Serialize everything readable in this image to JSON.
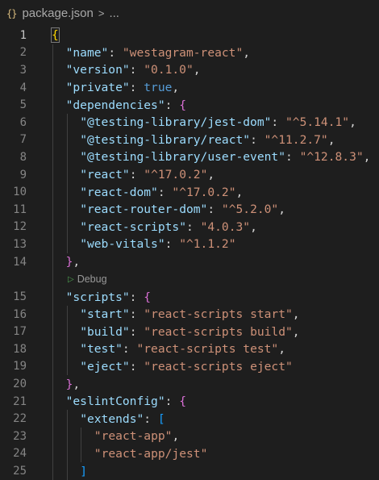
{
  "breadcrumb": {
    "icon": "{}",
    "file": "package.json",
    "more": "..."
  },
  "codelens": {
    "label": "Debug"
  },
  "lines": [
    {
      "n": "1",
      "tokens": [
        [
          "br0",
          "{"
        ]
      ]
    },
    {
      "n": "2",
      "tokens": [
        [
          "k",
          "\"name\""
        ],
        [
          "p",
          ": "
        ],
        [
          "s",
          "\"westagram-react\""
        ],
        [
          "p",
          ","
        ]
      ]
    },
    {
      "n": "3",
      "tokens": [
        [
          "k",
          "\"version\""
        ],
        [
          "p",
          ": "
        ],
        [
          "s",
          "\"0.1.0\""
        ],
        [
          "p",
          ","
        ]
      ]
    },
    {
      "n": "4",
      "tokens": [
        [
          "k",
          "\"private\""
        ],
        [
          "p",
          ": "
        ],
        [
          "b",
          "true"
        ],
        [
          "p",
          ","
        ]
      ]
    },
    {
      "n": "5",
      "tokens": [
        [
          "k",
          "\"dependencies\""
        ],
        [
          "p",
          ": "
        ],
        [
          "br1",
          "{"
        ]
      ]
    },
    {
      "n": "6",
      "tokens": [
        [
          "k",
          "\"@testing-library/jest-dom\""
        ],
        [
          "p",
          ": "
        ],
        [
          "s",
          "\"^5.14.1\""
        ],
        [
          "p",
          ","
        ]
      ]
    },
    {
      "n": "7",
      "tokens": [
        [
          "k",
          "\"@testing-library/react\""
        ],
        [
          "p",
          ": "
        ],
        [
          "s",
          "\"^11.2.7\""
        ],
        [
          "p",
          ","
        ]
      ]
    },
    {
      "n": "8",
      "tokens": [
        [
          "k",
          "\"@testing-library/user-event\""
        ],
        [
          "p",
          ": "
        ],
        [
          "s",
          "\"^12.8.3\""
        ],
        [
          "p",
          ","
        ]
      ]
    },
    {
      "n": "9",
      "tokens": [
        [
          "k",
          "\"react\""
        ],
        [
          "p",
          ": "
        ],
        [
          "s",
          "\"^17.0.2\""
        ],
        [
          "p",
          ","
        ]
      ]
    },
    {
      "n": "10",
      "tokens": [
        [
          "k",
          "\"react-dom\""
        ],
        [
          "p",
          ": "
        ],
        [
          "s",
          "\"^17.0.2\""
        ],
        [
          "p",
          ","
        ]
      ]
    },
    {
      "n": "11",
      "tokens": [
        [
          "k",
          "\"react-router-dom\""
        ],
        [
          "p",
          ": "
        ],
        [
          "s",
          "\"^5.2.0\""
        ],
        [
          "p",
          ","
        ]
      ]
    },
    {
      "n": "12",
      "tokens": [
        [
          "k",
          "\"react-scripts\""
        ],
        [
          "p",
          ": "
        ],
        [
          "s",
          "\"4.0.3\""
        ],
        [
          "p",
          ","
        ]
      ]
    },
    {
      "n": "13",
      "tokens": [
        [
          "k",
          "\"web-vitals\""
        ],
        [
          "p",
          ": "
        ],
        [
          "s",
          "\"^1.1.2\""
        ]
      ]
    },
    {
      "n": "14",
      "tokens": [
        [
          "br1",
          "}"
        ],
        [
          "p",
          ","
        ]
      ]
    },
    {
      "n": "15",
      "tokens": [
        [
          "k",
          "\"scripts\""
        ],
        [
          "p",
          ": "
        ],
        [
          "br1",
          "{"
        ]
      ]
    },
    {
      "n": "16",
      "tokens": [
        [
          "k",
          "\"start\""
        ],
        [
          "p",
          ": "
        ],
        [
          "s",
          "\"react-scripts start\""
        ],
        [
          "p",
          ","
        ]
      ]
    },
    {
      "n": "17",
      "tokens": [
        [
          "k",
          "\"build\""
        ],
        [
          "p",
          ": "
        ],
        [
          "s",
          "\"react-scripts build\""
        ],
        [
          "p",
          ","
        ]
      ]
    },
    {
      "n": "18",
      "tokens": [
        [
          "k",
          "\"test\""
        ],
        [
          "p",
          ": "
        ],
        [
          "s",
          "\"react-scripts test\""
        ],
        [
          "p",
          ","
        ]
      ]
    },
    {
      "n": "19",
      "tokens": [
        [
          "k",
          "\"eject\""
        ],
        [
          "p",
          ": "
        ],
        [
          "s",
          "\"react-scripts eject\""
        ]
      ]
    },
    {
      "n": "20",
      "tokens": [
        [
          "br1",
          "}"
        ],
        [
          "p",
          ","
        ]
      ]
    },
    {
      "n": "21",
      "tokens": [
        [
          "k",
          "\"eslintConfig\""
        ],
        [
          "p",
          ": "
        ],
        [
          "br1",
          "{"
        ]
      ]
    },
    {
      "n": "22",
      "tokens": [
        [
          "k",
          "\"extends\""
        ],
        [
          "p",
          ": "
        ],
        [
          "br2",
          "["
        ]
      ]
    },
    {
      "n": "23",
      "tokens": [
        [
          "s",
          "\"react-app\""
        ],
        [
          "p",
          ","
        ]
      ]
    },
    {
      "n": "24",
      "tokens": [
        [
          "s",
          "\"react-app/jest\""
        ]
      ]
    },
    {
      "n": "25",
      "tokens": [
        [
          "br2",
          "]"
        ]
      ]
    }
  ],
  "colors": {
    "background": "#1e1e1e",
    "key": "#9cdcfe",
    "string": "#ce9178",
    "boolean": "#569cd6",
    "bracket_level_1": "#ffd700",
    "bracket_level_2": "#da70d6",
    "bracket_level_3": "#179fff"
  }
}
